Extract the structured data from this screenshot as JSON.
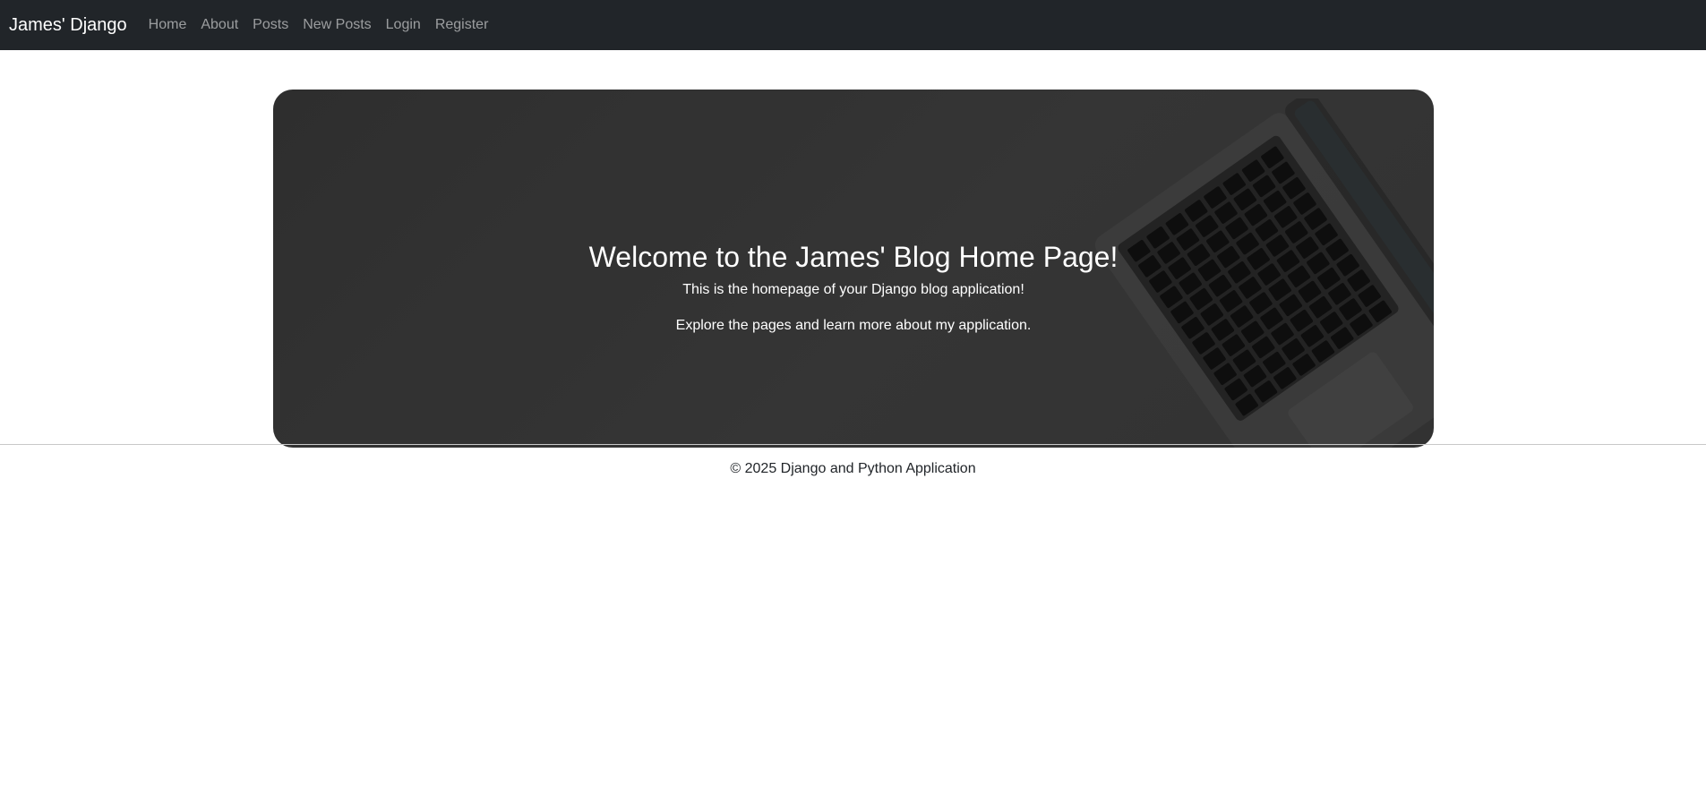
{
  "navbar": {
    "brand": "James' Django",
    "links": [
      {
        "label": "Home"
      },
      {
        "label": "About"
      },
      {
        "label": "Posts"
      },
      {
        "label": "New Posts"
      },
      {
        "label": "Login"
      },
      {
        "label": "Register"
      }
    ],
    "background": "#212529",
    "link_color": "rgba(255,255,255,0.55)"
  },
  "hero": {
    "title": "Welcome to the James' Blog Home Page!",
    "subtitle": "This is the homepage of your Django blog application!",
    "description": "Explore the pages and learn more about my application.",
    "image_icon": "laptop-keyboard-icon",
    "background": "#3a3a3a"
  },
  "footer": {
    "text": "© 2025 Django and Python Application"
  }
}
